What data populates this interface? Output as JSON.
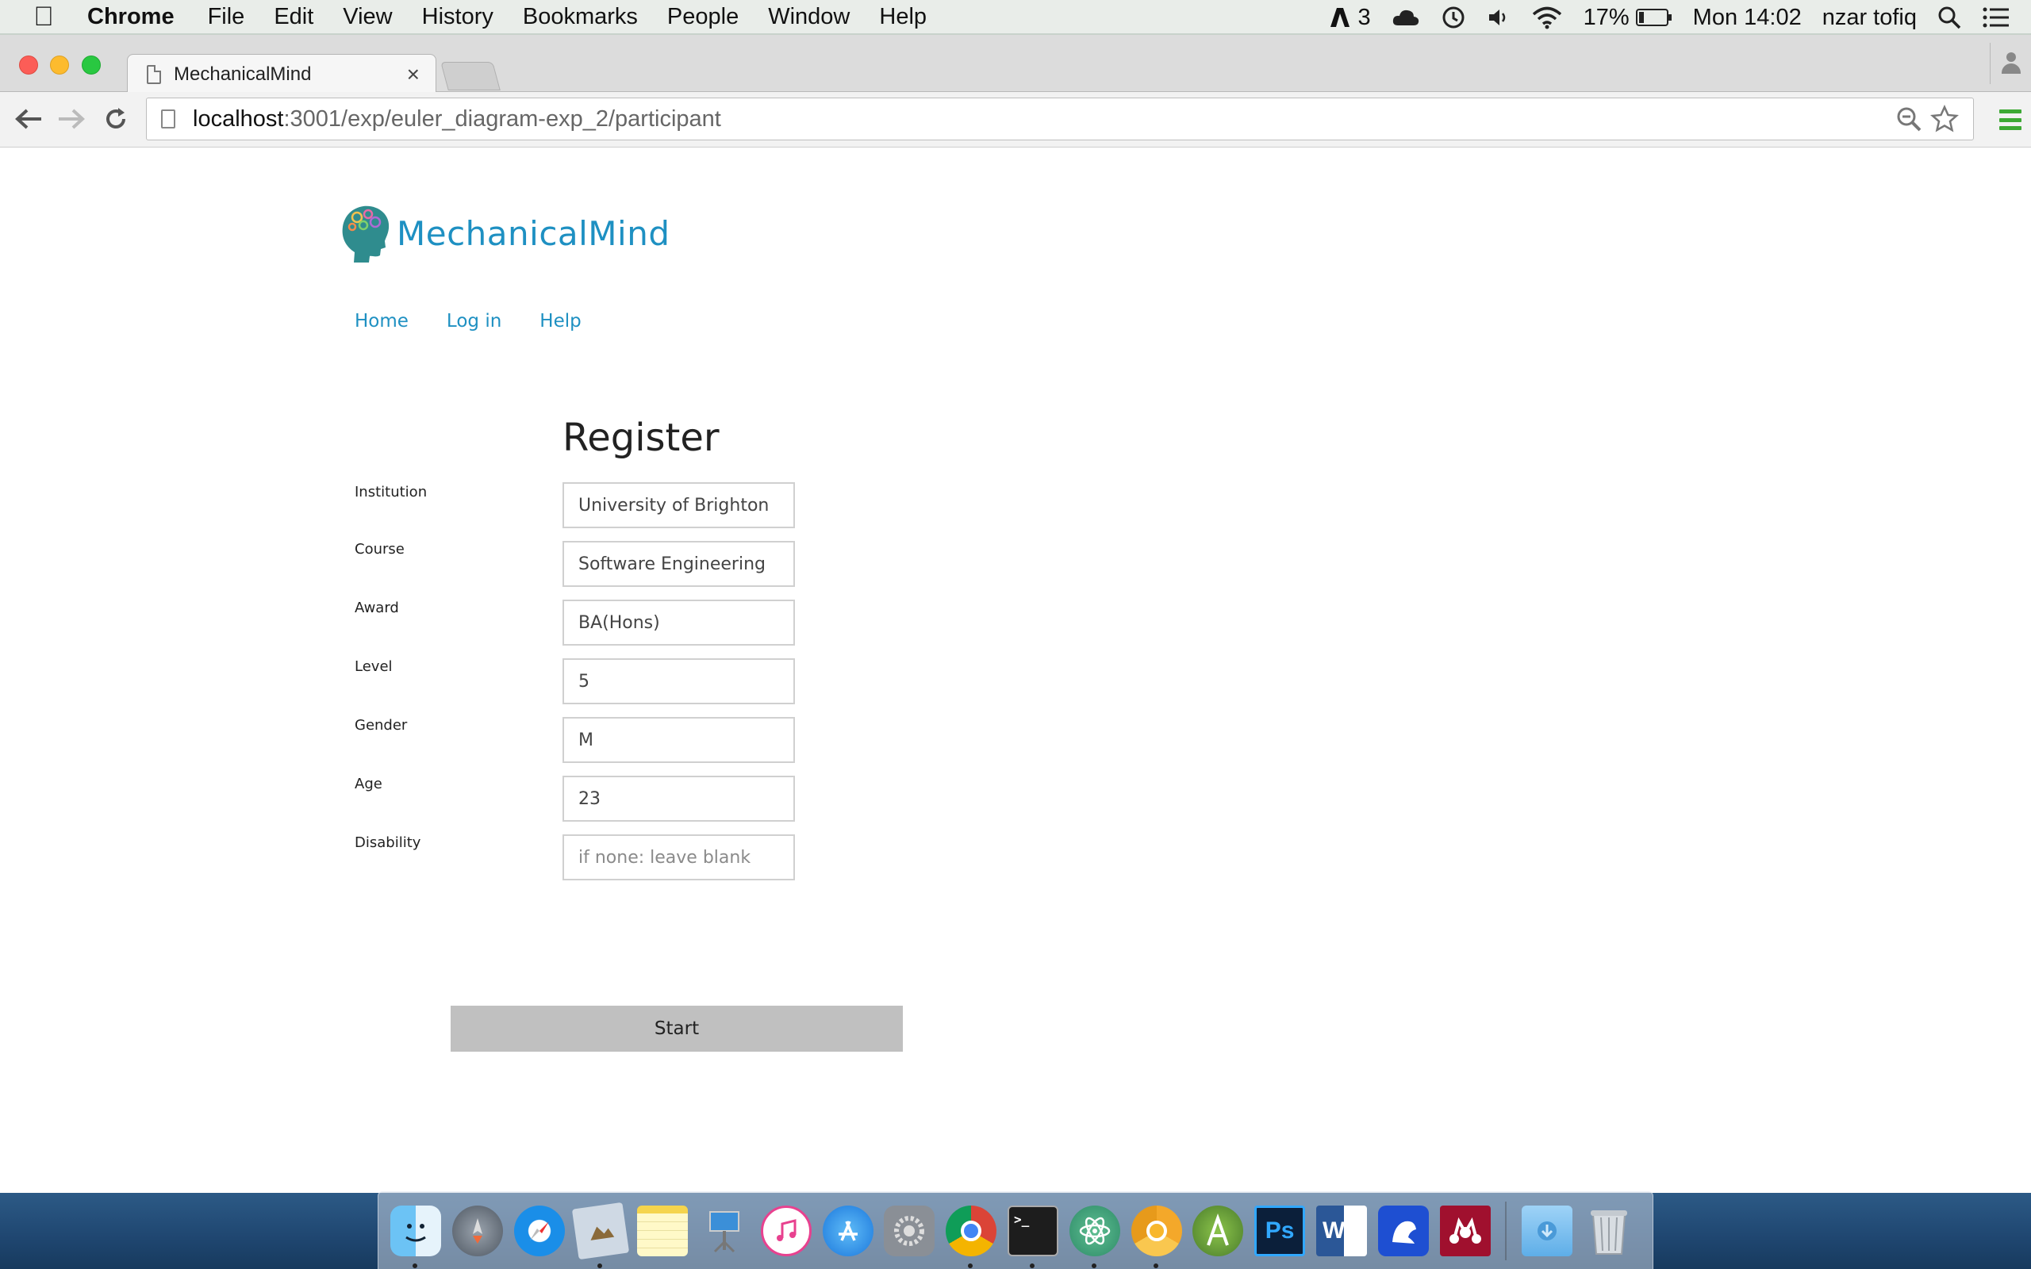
{
  "menubar": {
    "app_name": "Chrome",
    "items": [
      "File",
      "Edit",
      "View",
      "History",
      "Bookmarks",
      "People",
      "Window",
      "Help"
    ],
    "status": {
      "adobe_count": "3",
      "battery_percent": "17%",
      "clock": "Mon 14:02",
      "user": "nzar tofiq"
    }
  },
  "browser": {
    "tab_title": "MechanicalMind",
    "url_host": "localhost",
    "url_path": ":3001/exp/euler_diagram-exp_2/participant"
  },
  "site": {
    "name": "MechanicalMind",
    "nav": [
      "Home",
      "Log in",
      "Help"
    ]
  },
  "form": {
    "title": "Register",
    "fields": [
      {
        "label": "Institution",
        "value": "University of Brighton",
        "placeholder": ""
      },
      {
        "label": "Course",
        "value": "Software Engineering",
        "placeholder": ""
      },
      {
        "label": "Award",
        "value": "BA(Hons)",
        "placeholder": ""
      },
      {
        "label": "Level",
        "value": "5",
        "placeholder": ""
      },
      {
        "label": "Gender",
        "value": "M",
        "placeholder": ""
      },
      {
        "label": "Age",
        "value": "23",
        "placeholder": ""
      },
      {
        "label": "Disability",
        "value": "",
        "placeholder": "if none: leave blank"
      }
    ],
    "submit_label": "Start"
  },
  "dock": {
    "apps": [
      "finder-icon",
      "launchpad-icon",
      "safari-icon",
      "preview-icon",
      "notes-icon",
      "keynote-icon",
      "itunes-icon",
      "app-store-icon",
      "system-preferences-icon",
      "chrome-icon",
      "terminal-icon",
      "atom-icon",
      "chrome-canary-icon",
      "android-studio-icon",
      "photoshop-icon",
      "word-icon",
      "frog-icon",
      "mendeley-icon",
      "downloads-folder-icon",
      "trash-icon"
    ],
    "photoshop_label": "Ps",
    "word_label": "W"
  },
  "colors": {
    "link": "#1e90c2",
    "button_bg": "#c0c0c0",
    "chrome_menu": "#3da934"
  }
}
